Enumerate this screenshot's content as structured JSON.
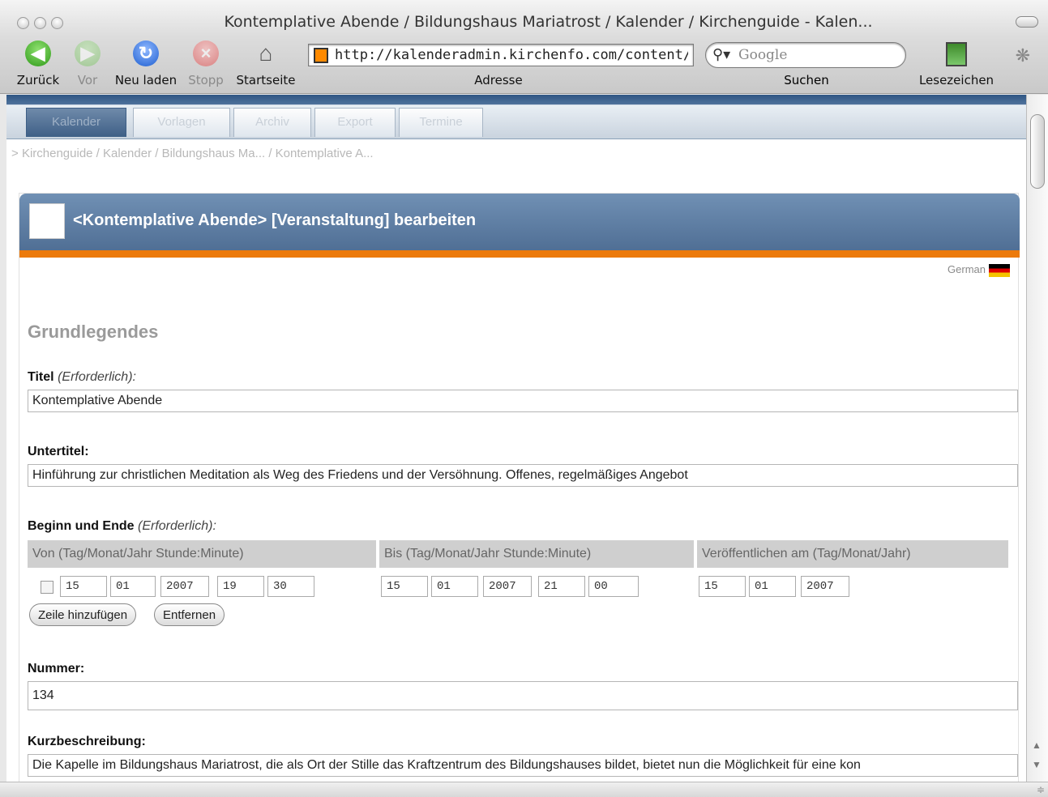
{
  "window": {
    "title": "Kontemplative Abende / Bildungshaus Mariatrost / Kalender / Kirchenguide - Kalen..."
  },
  "toolbar": {
    "back_label": "Zurück",
    "forward_label": "Vor",
    "reload_label": "Neu laden",
    "stop_label": "Stopp",
    "home_label": "Startseite",
    "address_value": "http://kalenderadmin.kirchenfo.com/content/",
    "address_label": "Adresse",
    "search_placeholder": "Google",
    "search_label": "Suchen",
    "bookmarks_label": "Lesezeichen"
  },
  "cms": {
    "tabs": [
      {
        "label": "Kalender",
        "active": true
      },
      {
        "label": "Vorlagen",
        "active": false
      },
      {
        "label": "Archiv",
        "active": false
      },
      {
        "label": "Export",
        "active": false
      },
      {
        "label": "Termine",
        "active": false
      }
    ],
    "breadcrumb": {
      "prefix": ">",
      "items": [
        "Kirchenguide",
        "Kalender",
        "Bildungshaus Ma...",
        "Kontemplative A..."
      ]
    }
  },
  "panel": {
    "title": "<Kontemplative Abende> [Veranstaltung] bearbeiten",
    "language": "German",
    "section_heading": "Grundlegendes"
  },
  "form": {
    "titel": {
      "label": "Titel",
      "required_note": "(Erforderlich):",
      "value": "Kontemplative Abende"
    },
    "untertitel": {
      "label": "Untertitel:",
      "value": "Hinführung zur christlichen Meditation als Weg des Friedens und der Versöhnung. Offenes, regelmäßiges Angebot"
    },
    "beginn_ende": {
      "label": "Beginn und Ende",
      "required_note": "(Erforderlich):",
      "col_von": "Von (Tag/Monat/Jahr Stunde:Minute)",
      "col_bis": "Bis (Tag/Monat/Jahr Stunde:Minute)",
      "col_veroeffentlichen": "Veröffentlichen am (Tag/Monat/Jahr)",
      "von": {
        "day": "15",
        "month": "01",
        "year": "2007",
        "hour": "19",
        "minute": "30"
      },
      "bis": {
        "day": "15",
        "month": "01",
        "year": "2007",
        "hour": "21",
        "minute": "00"
      },
      "veroeffentlichen": {
        "day": "15",
        "month": "01",
        "year": "2007"
      },
      "add_row_label": "Zeile hinzufügen",
      "remove_label": "Entfernen"
    },
    "nummer": {
      "label": "Nummer:",
      "value": "134"
    },
    "kurzbeschreibung": {
      "label": "Kurzbeschreibung:",
      "value": "Die Kapelle im Bildungshaus Mariatrost, die als Ort der Stille das Kraftzentrum des Bildungshauses bildet, bietet nun die Möglichkeit für eine kon"
    }
  },
  "colors": {
    "header_blue": "#506f95",
    "accent_orange": "#ec7a0b"
  }
}
